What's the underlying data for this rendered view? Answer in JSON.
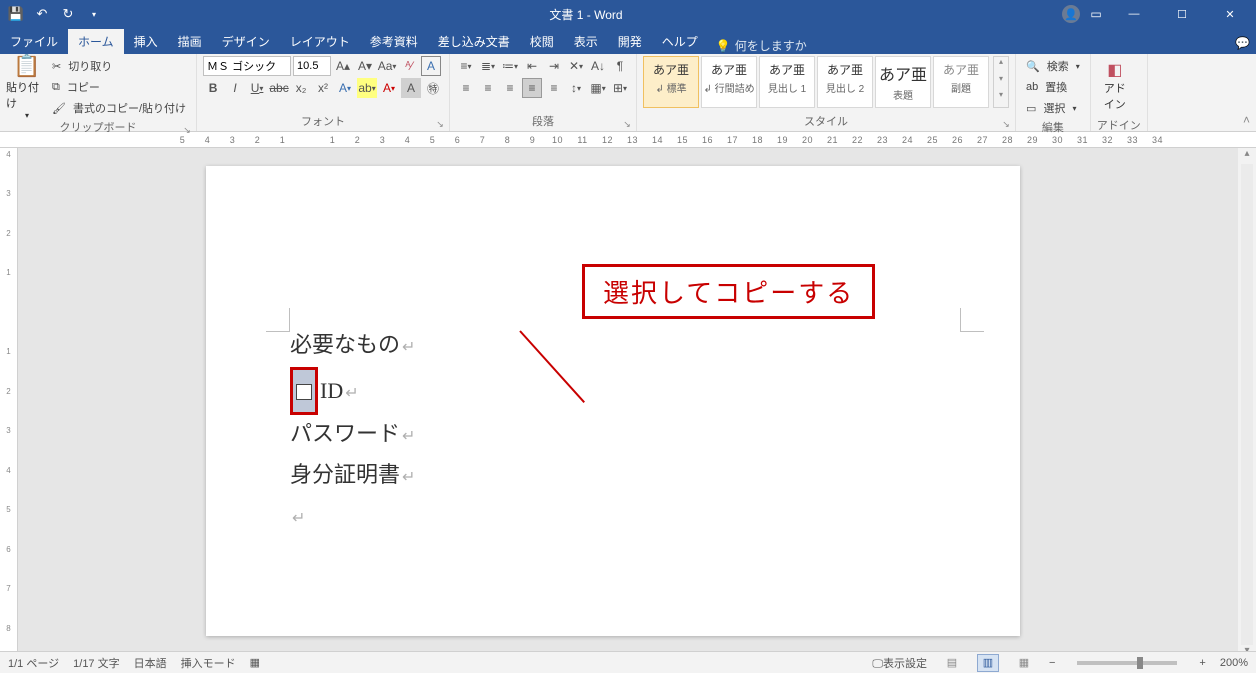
{
  "title": "文書 1  -  Word",
  "tabs": {
    "file": "ファイル",
    "home": "ホーム",
    "insert": "挿入",
    "draw": "描画",
    "design": "デザイン",
    "layout": "レイアウト",
    "references": "参考資料",
    "mailings": "差し込み文書",
    "review": "校閲",
    "view": "表示",
    "developer": "開発",
    "help": "ヘルプ",
    "tellme": "何をしますか"
  },
  "clipboard": {
    "paste": "貼り付け",
    "cut": "切り取り",
    "copy": "コピー",
    "formatpainter": "書式のコピー/貼り付け",
    "label": "クリップボード"
  },
  "font": {
    "name": "ＭＳ ゴシック",
    "size": "10.5",
    "label": "フォント"
  },
  "paragraph": {
    "label": "段落"
  },
  "styles": {
    "label": "スタイル",
    "items": [
      {
        "sample": "あア亜",
        "name": "↲ 標準"
      },
      {
        "sample": "あア亜",
        "name": "↲ 行間詰め"
      },
      {
        "sample": "あア亜",
        "name": "見出し 1"
      },
      {
        "sample": "あア亜",
        "name": "見出し 2"
      },
      {
        "sample": "あア亜",
        "name": "表題"
      },
      {
        "sample": "あア亜",
        "name": "副題"
      }
    ]
  },
  "editing": {
    "find": "検索",
    "replace": "置換",
    "select": "選択",
    "label": "編集"
  },
  "addin": {
    "label": "アドイン",
    "btn": "アド\nイン"
  },
  "document": {
    "line1": "必要なもの",
    "line2": "ID",
    "line3": "パスワード",
    "line4": "身分証明書"
  },
  "callout": "選択してコピーする",
  "status": {
    "page": "1/1 ページ",
    "words": "1/17 文字",
    "lang": "日本語",
    "mode": "挿入モード",
    "display": "表示設定",
    "zoom": "200%"
  },
  "ruler_h": [
    "5",
    "4",
    "3",
    "2",
    "1",
    "",
    "1",
    "2",
    "3",
    "4",
    "5",
    "6",
    "7",
    "8",
    "9",
    "10",
    "11",
    "12",
    "13",
    "14",
    "15",
    "16",
    "17",
    "18",
    "19",
    "20",
    "21",
    "22",
    "23",
    "24",
    "25",
    "26",
    "27",
    "28",
    "29",
    "30",
    "31",
    "32",
    "33",
    "34"
  ],
  "ruler_v": [
    "4",
    "3",
    "2",
    "1",
    "",
    "1",
    "2",
    "3",
    "4",
    "5",
    "6",
    "7",
    "8"
  ]
}
